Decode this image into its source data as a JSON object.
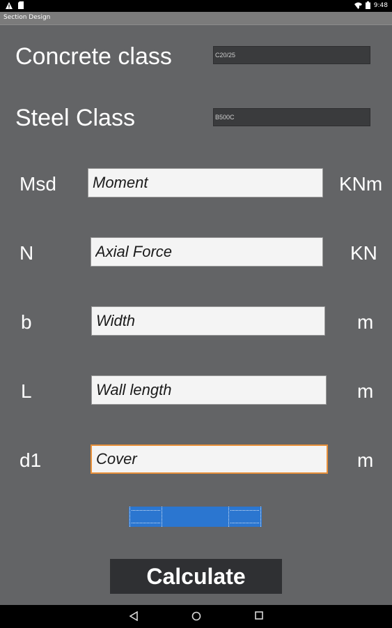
{
  "status_bar": {
    "time": "9:48",
    "icons": [
      "warning-icon",
      "sd-card-icon",
      "wifi-icon",
      "battery-icon"
    ]
  },
  "app_bar": {
    "title": "Section Design"
  },
  "concrete": {
    "label": "Concrete class",
    "selected": "C20/25"
  },
  "steel": {
    "label": "Steel Class",
    "selected": "B500C"
  },
  "fields": {
    "msd": {
      "label": "Msd",
      "placeholder": "Moment",
      "unit": "KNm"
    },
    "n": {
      "label": "N",
      "placeholder": "Axial Force",
      "unit": "KN"
    },
    "b": {
      "label": "b",
      "placeholder": "Width",
      "unit": "m"
    },
    "l": {
      "label": "L",
      "placeholder": "Wall length",
      "unit": "m"
    },
    "d1": {
      "label": "d1",
      "placeholder": "Cover",
      "unit": "m"
    }
  },
  "progress": {
    "indeterminate": true,
    "color": "#2b76d0"
  },
  "calculate_label": "Calculate",
  "colors": {
    "background": "#636466",
    "focus_border": "#e8903a",
    "button": "#2f3033"
  },
  "nav_bar": {
    "icons": [
      "back-icon",
      "home-icon",
      "recents-icon"
    ]
  }
}
